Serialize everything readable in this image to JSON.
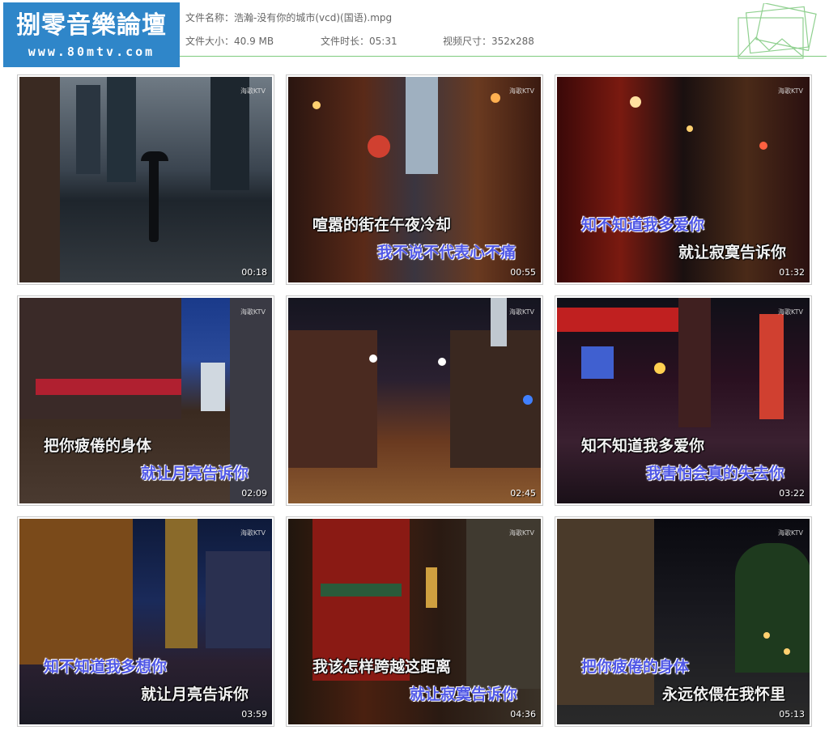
{
  "logo": {
    "title": "捌零音樂論壇",
    "url": "www.80mtv.com"
  },
  "file": {
    "name_label": "文件名称：",
    "name": "浩瀚-没有你的城市(vcd)(国语).mpg",
    "size_label": "文件大小：",
    "size": "40.9 MB",
    "duration_label": "文件时长：",
    "duration": "05:31",
    "dims_label": "视频尺寸：",
    "dims": "352x288"
  },
  "watermark": "海歌KTV",
  "thumbs": [
    {
      "time": "00:18",
      "line1": "",
      "line2": ""
    },
    {
      "time": "00:55",
      "line1": "喧嚣的街在午夜冷却",
      "line2": "我不说不代表心不痛"
    },
    {
      "time": "01:32",
      "line1": "知不知道我多爱你",
      "line2": "就让寂寞告诉你"
    },
    {
      "time": "02:09",
      "line1": "把你疲倦的身体",
      "line2": "就让月亮告诉你"
    },
    {
      "time": "02:45",
      "line1": "",
      "line2": ""
    },
    {
      "time": "03:22",
      "line1": "知不知道我多爱你",
      "line2": "我害怕会真的失去你"
    },
    {
      "time": "03:59",
      "line1": "知不知道我多想你",
      "line2": "就让月亮告诉你"
    },
    {
      "time": "04:36",
      "line1": "我该怎样跨越这距离",
      "line2": "就让寂寞告诉你"
    },
    {
      "time": "05:13",
      "line1": "把你疲倦的身体",
      "line2": "永远依偎在我怀里"
    }
  ]
}
